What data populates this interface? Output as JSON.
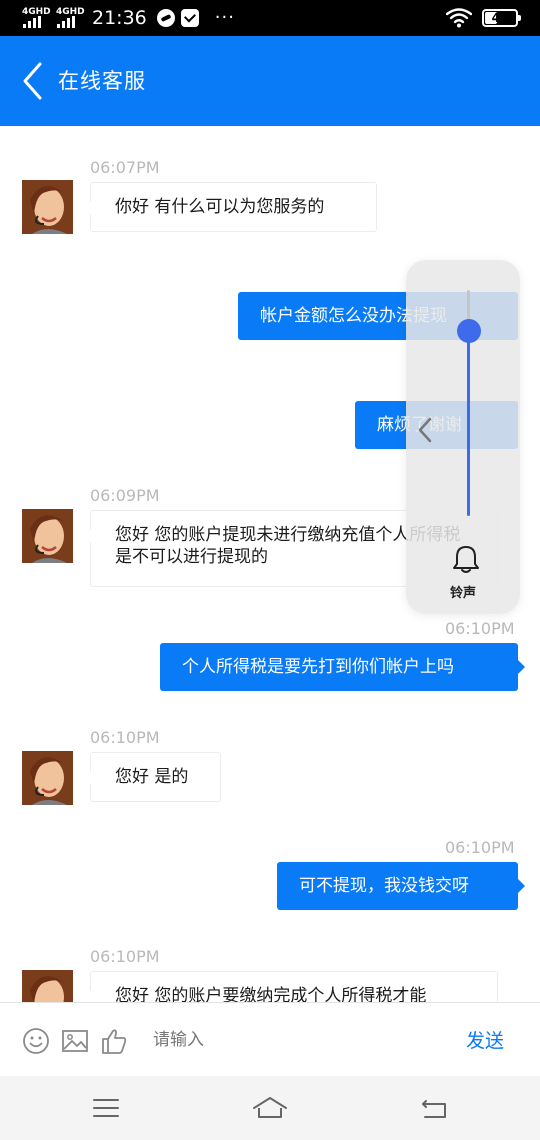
{
  "status_bar": {
    "network_1": "4GHD",
    "network_2": "4GHD",
    "time": "21:36",
    "more": "···",
    "battery": "41",
    "battery_level": 0.41,
    "icons": [
      "signal-icon",
      "app-notification-icon",
      "mail-notification-icon",
      "wifi-icon",
      "battery-icon"
    ]
  },
  "header": {
    "title": "在线客服",
    "back_icon": "chevron-left-icon"
  },
  "messages": [
    {
      "from": "agent",
      "time": "06:07PM",
      "text": "你好 有什么可以为您服务的"
    },
    {
      "from": "user",
      "text": "帐户金额怎么没办法提现"
    },
    {
      "from": "user",
      "text": "麻烦了谢谢"
    },
    {
      "from": "agent",
      "time": "06:09PM",
      "text": "您好 您的账户提现未进行缴纳充值个人所得税 是不可以进行提现的"
    },
    {
      "from": "user",
      "time": "06:10PM",
      "text": "个人所得税是要先打到你们帐户上吗"
    },
    {
      "from": "agent",
      "time": "06:10PM",
      "text": "您好 是的"
    },
    {
      "from": "user",
      "time": "06:10PM",
      "text": "可不提现，我没钱交呀"
    },
    {
      "from": "agent",
      "time": "06:10PM",
      "text": "您好 您的账户要缴纳完成个人所得税才能"
    }
  ],
  "volume_panel": {
    "label": "铃声",
    "level": 0.82,
    "icon": "bell-icon"
  },
  "input_bar": {
    "placeholder": "请输入",
    "value": "",
    "send_label": "发送",
    "icons": [
      "emoji-icon",
      "image-icon",
      "thumbs-up-icon"
    ]
  },
  "nav_bar": {
    "icons": [
      "menu-icon",
      "home-icon",
      "back-icon"
    ]
  },
  "colors": {
    "accent": "#0a7bf6",
    "slider": "#3d6bea",
    "timestamp": "#b9b9b9"
  }
}
